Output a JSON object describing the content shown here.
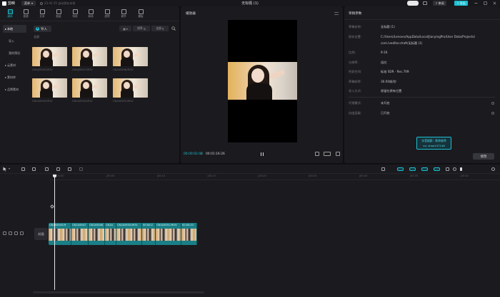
{
  "app": {
    "name": "剪映",
    "menu_label": "菜单",
    "autosave": "23:41:15 自动保存本地",
    "doc_title": "无标题 (1)",
    "share_label": "审阅",
    "export_label": "导出",
    "accent": "#1dbfd1"
  },
  "media_toolbar": [
    {
      "label": "媒体",
      "icon": "media-icon",
      "active": true
    },
    {
      "label": "音频",
      "icon": "audio-icon"
    },
    {
      "label": "文本",
      "icon": "text-icon"
    },
    {
      "label": "贴纸",
      "icon": "sticker-icon"
    },
    {
      "label": "特效",
      "icon": "effects-icon"
    },
    {
      "label": "转场",
      "icon": "transition-icon"
    },
    {
      "label": "滤镜",
      "icon": "filter-icon"
    },
    {
      "label": "调节",
      "icon": "adjust-icon"
    },
    {
      "label": "模板",
      "icon": "template-icon"
    }
  ],
  "sidebar": {
    "items": [
      {
        "label": "本地",
        "active": true
      },
      {
        "label": "导入",
        "sub": true
      },
      {
        "label": "我的预设",
        "sub": true
      },
      {
        "label": "云素材"
      },
      {
        "label": "素材库"
      },
      {
        "label": "品牌素材"
      }
    ]
  },
  "media": {
    "import_label": "导入",
    "all_label": "全部",
    "sort_label": "排序",
    "filter_label": "全部",
    "thumbnails": [
      {
        "name": "CN1A5545.MOV"
      },
      {
        "name": "CN1A5547.MOV"
      },
      {
        "name": "CN1A5548.MOV"
      },
      {
        "name": "CN1A5549.MOV"
      },
      {
        "name": "CN1A5550.MOV"
      },
      {
        "name": "CN1A5551.MOV"
      }
    ]
  },
  "player": {
    "title": "播放器",
    "current_time": "00:00:02:08",
    "total_time": "00:01:16:26"
  },
  "properties": {
    "title": "草稿参数",
    "rows": [
      {
        "key": "草稿名称:",
        "value": "无标题 (1)"
      },
      {
        "key": "保存位置:",
        "value": "C:/Users/Lenovo/AppData/Local/JianyingPro/User Data/Projects/",
        "value2": "com.lveditor.draft/无标题 (1)"
      },
      {
        "key": "比例:",
        "value": "9:16"
      },
      {
        "key": "分辨率:",
        "value": "适应"
      },
      {
        "key": "色彩空间:",
        "value": "标准 SDR - Rec.709"
      },
      {
        "key": "草稿帧率:",
        "value": "30.00帧/秒"
      },
      {
        "key": "导入方式:",
        "value": "保留在原有位置"
      }
    ],
    "rows2": [
      {
        "key": "代理模式:",
        "value": "未开启"
      },
      {
        "key": "自由层级:",
        "value": "已开启"
      }
    ],
    "watermark_line1": "抖音搜索：陈昂老师",
    "watermark_line2": "vx: zhao147146",
    "modify_label": "修改"
  },
  "timeline": {
    "ticks": [
      "|00:00",
      "|00:05",
      "|00:10",
      "|00:15",
      "|00:20",
      "|00:25",
      "|00:30",
      "|00:35",
      "|00:40",
      "|00:45"
    ],
    "cover_label": "封面",
    "clips": [
      {
        "name": "CN1A5545.M"
      },
      {
        "name": "CN1A5547."
      },
      {
        "name": "CN1A5548"
      },
      {
        "name": "CN1A"
      },
      {
        "name": "CN1A5550.MOV"
      },
      {
        "name": "00:00:2"
      },
      {
        "name": "CN1A5551.MOV"
      },
      {
        "name": "00:00:21"
      }
    ]
  }
}
